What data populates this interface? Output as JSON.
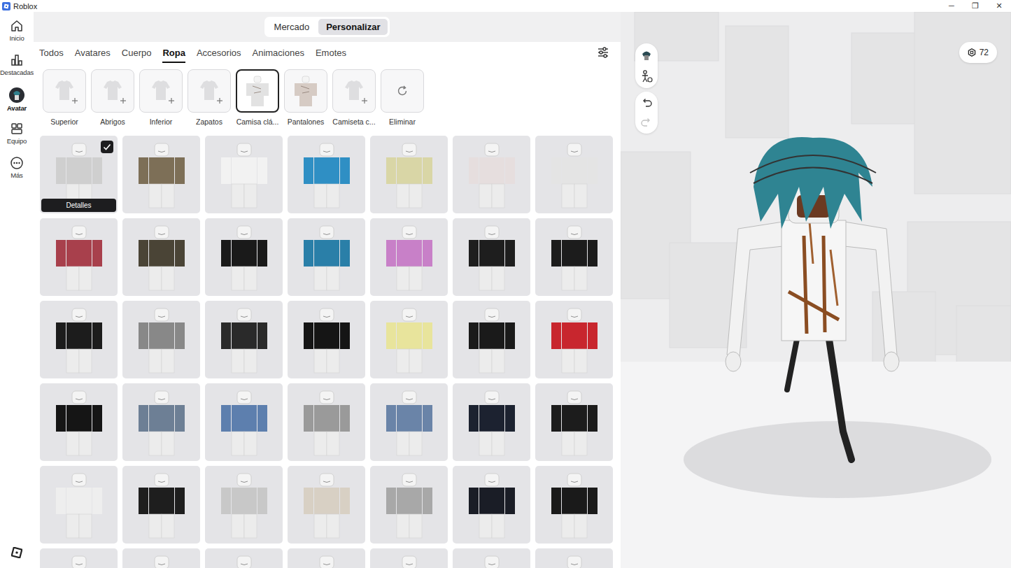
{
  "window": {
    "title": "Roblox",
    "controls": [
      "─",
      "❐",
      "✕"
    ]
  },
  "sidebar": {
    "items": [
      {
        "label": "Inicio",
        "selected": false
      },
      {
        "label": "Destacadas",
        "selected": false
      },
      {
        "label": "Avatar",
        "selected": true
      },
      {
        "label": "Equipo",
        "selected": false
      },
      {
        "label": "Más",
        "selected": false
      }
    ]
  },
  "toggle": {
    "items": [
      {
        "label": "Mercado",
        "selected": false
      },
      {
        "label": "Personalizar",
        "selected": true
      }
    ]
  },
  "tabs": [
    {
      "label": "Todos",
      "selected": false
    },
    {
      "label": "Avatares",
      "selected": false
    },
    {
      "label": "Cuerpo",
      "selected": false
    },
    {
      "label": "Ropa",
      "selected": true
    },
    {
      "label": "Accesorios",
      "selected": false
    },
    {
      "label": "Animaciones",
      "selected": false
    },
    {
      "label": "Emotes",
      "selected": false
    }
  ],
  "categories": [
    {
      "label": "Superior",
      "kind": "add",
      "selected": false
    },
    {
      "label": "Abrigos",
      "kind": "add",
      "selected": false
    },
    {
      "label": "Inferior",
      "kind": "add",
      "selected": false
    },
    {
      "label": "Zapatos",
      "kind": "add",
      "selected": false
    },
    {
      "label": "Camisa clá...",
      "kind": "equipped",
      "selected": true,
      "color": "#e2e2e2"
    },
    {
      "label": "Pantalones",
      "kind": "equipped",
      "selected": false,
      "color": "#d6cbc4"
    },
    {
      "label": "Camiseta c...",
      "kind": "add",
      "selected": false
    },
    {
      "label": "Eliminar",
      "kind": "remove",
      "selected": false
    }
  ],
  "grid": {
    "hover_label": "Detalles",
    "items": [
      {
        "color": "#cfcfcf",
        "checked": true,
        "hovered": true
      },
      {
        "color": "#7d6f57",
        "checked": false,
        "hovered": false
      },
      {
        "color": "#f2f2f2",
        "checked": false,
        "hovered": false
      },
      {
        "color": "#2f8fc4",
        "checked": false,
        "hovered": false
      },
      {
        "color": "#d9d6a6",
        "checked": false,
        "hovered": false
      },
      {
        "color": "#e6dede",
        "checked": false,
        "hovered": false
      },
      {
        "color": "#e4e4e4",
        "checked": false,
        "hovered": false
      },
      {
        "color": "#a8404c",
        "checked": false,
        "hovered": false
      },
      {
        "color": "#4a4436",
        "checked": false,
        "hovered": false
      },
      {
        "color": "#1a1a1a",
        "checked": false,
        "hovered": false
      },
      {
        "color": "#2a7fa8",
        "checked": false,
        "hovered": false
      },
      {
        "color": "#c880c8",
        "checked": false,
        "hovered": false
      },
      {
        "color": "#1e1e1e",
        "checked": false,
        "hovered": false
      },
      {
        "color": "#1c1c1c",
        "checked": false,
        "hovered": false
      },
      {
        "color": "#1c1c1c",
        "checked": false,
        "hovered": false
      },
      {
        "color": "#888888",
        "checked": false,
        "hovered": false
      },
      {
        "color": "#2a2a2a",
        "checked": false,
        "hovered": false
      },
      {
        "color": "#151515",
        "checked": false,
        "hovered": false
      },
      {
        "color": "#e8e49c",
        "checked": false,
        "hovered": false
      },
      {
        "color": "#1a1a1a",
        "checked": false,
        "hovered": false
      },
      {
        "color": "#c8262e",
        "checked": false,
        "hovered": false
      },
      {
        "color": "#151515",
        "checked": false,
        "hovered": false
      },
      {
        "color": "#6d7f95",
        "checked": false,
        "hovered": false
      },
      {
        "color": "#5d7fae",
        "checked": false,
        "hovered": false
      },
      {
        "color": "#9a9a9a",
        "checked": false,
        "hovered": false
      },
      {
        "color": "#6a84a8",
        "checked": false,
        "hovered": false
      },
      {
        "color": "#1c2230",
        "checked": false,
        "hovered": false
      },
      {
        "color": "#1c1c1c",
        "checked": false,
        "hovered": false
      },
      {
        "color": "#eeeeee",
        "checked": false,
        "hovered": false
      },
      {
        "color": "#1e1e1e",
        "checked": false,
        "hovered": false
      },
      {
        "color": "#c8c8c8",
        "checked": false,
        "hovered": false
      },
      {
        "color": "#d8d0c4",
        "checked": false,
        "hovered": false
      },
      {
        "color": "#a8a8a8",
        "checked": false,
        "hovered": false
      },
      {
        "color": "#1a1d26",
        "checked": false,
        "hovered": false
      },
      {
        "color": "#1a1a1a",
        "checked": false,
        "hovered": false
      },
      {
        "color": "#e2e2e2",
        "checked": false,
        "hovered": false
      },
      {
        "color": "#1c1c1c",
        "checked": false,
        "hovered": false
      },
      {
        "color": "#1a1a1a",
        "checked": false,
        "hovered": false
      },
      {
        "color": "#d0d0d0",
        "checked": false,
        "hovered": false
      },
      {
        "color": "#e6e6e6",
        "checked": false,
        "hovered": false
      },
      {
        "color": "#1a1a1a",
        "checked": false,
        "hovered": false
      },
      {
        "color": "#202020",
        "checked": false,
        "hovered": false
      }
    ]
  },
  "viewport": {
    "currency": "72",
    "undo": {
      "disabled": false
    },
    "redo": {
      "disabled": true
    }
  }
}
